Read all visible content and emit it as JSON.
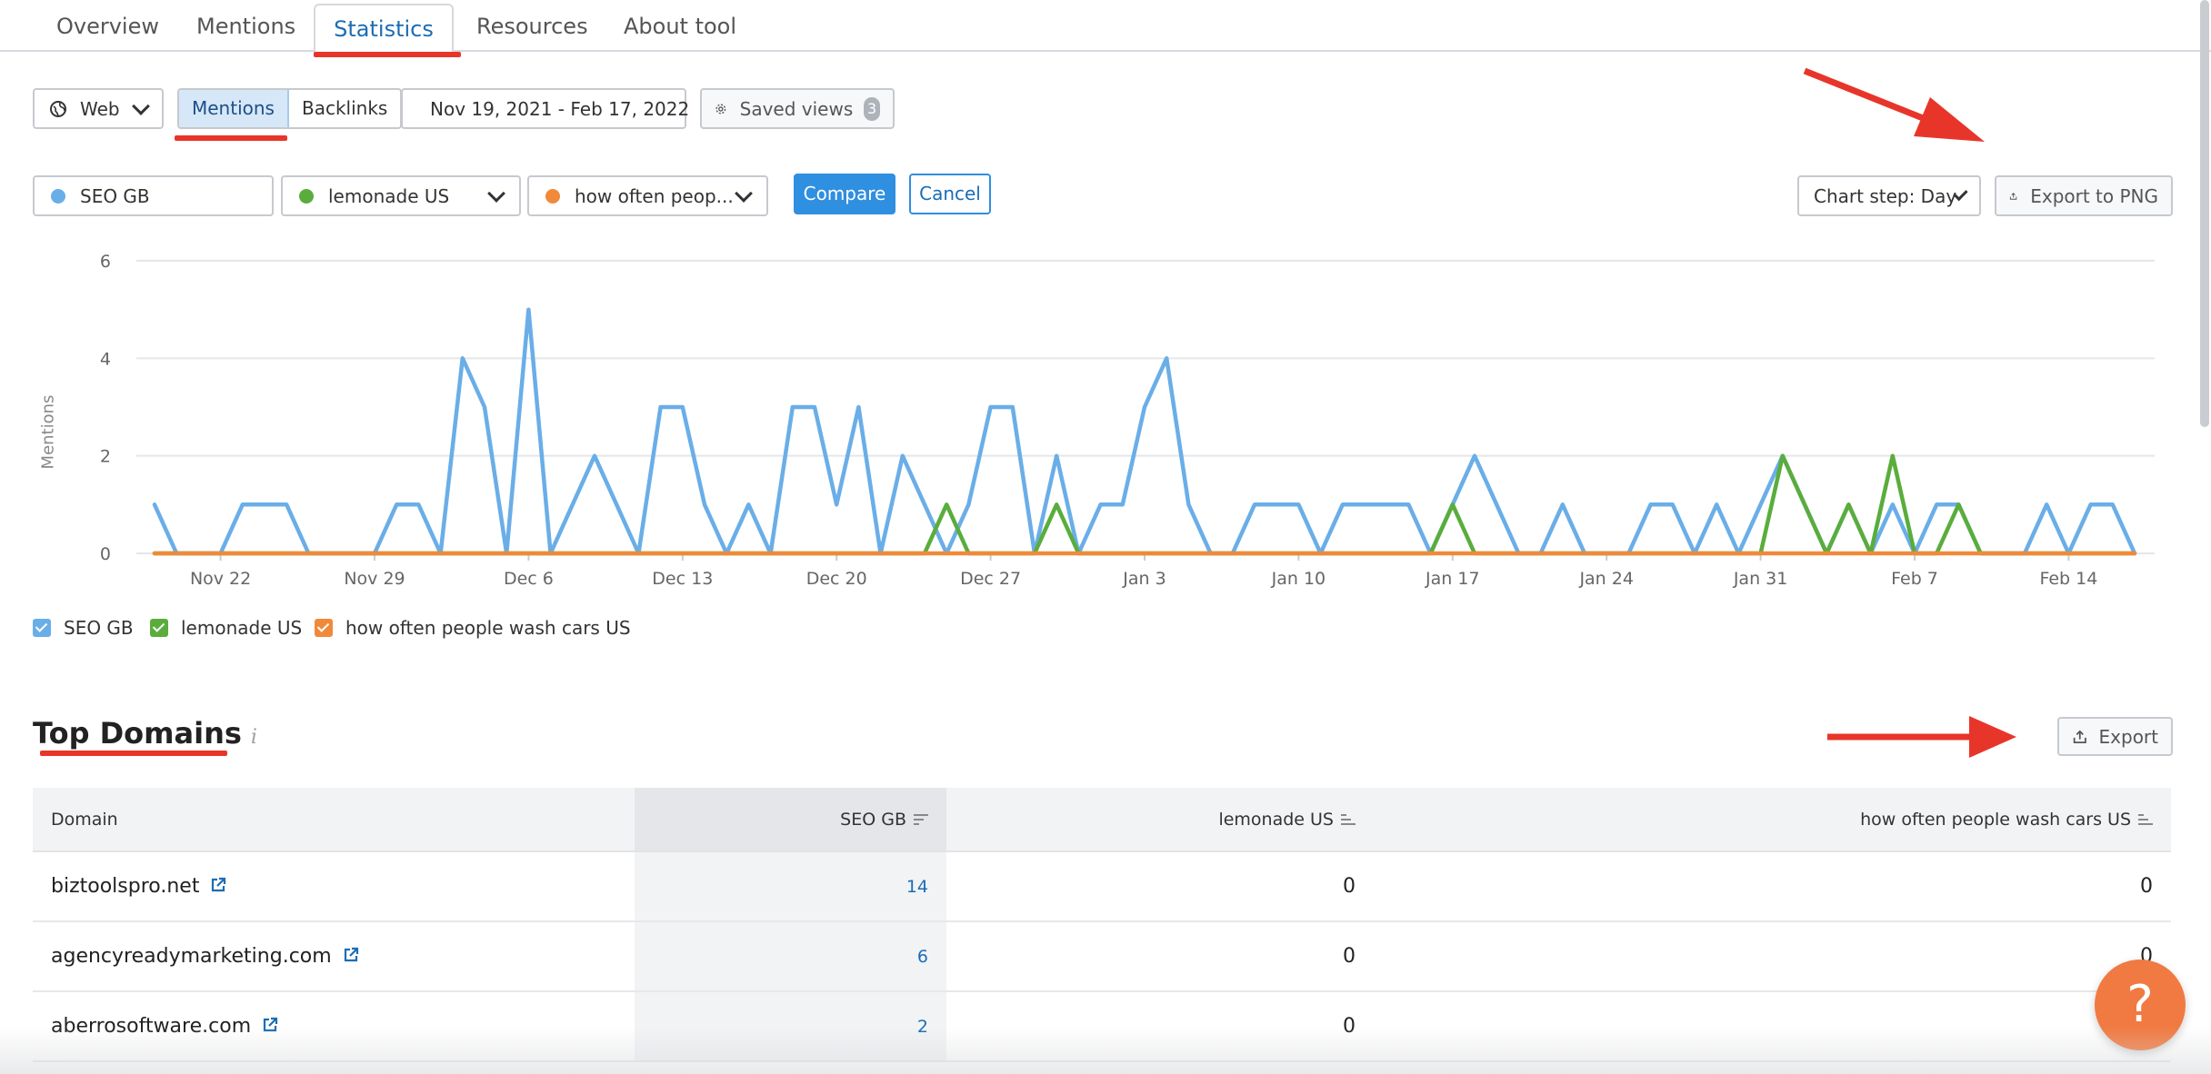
{
  "tabs": [
    {
      "label": "Overview"
    },
    {
      "label": "Mentions"
    },
    {
      "label": "Statistics"
    },
    {
      "label": "Resources"
    },
    {
      "label": "About tool"
    }
  ],
  "toolbar": {
    "source_label": "Web",
    "mentions_label": "Mentions",
    "backlinks_label": "Backlinks",
    "date_range": "Nov 19, 2021 - Feb 17, 2022",
    "saved_views_label": "Saved views",
    "saved_views_count": "3"
  },
  "compare": {
    "query1": "SEO GB",
    "query2": "lemonade US",
    "query3": "how often peop...",
    "compare_label": "Compare",
    "cancel_label": "Cancel",
    "chart_step": "Chart step: Day",
    "export_png": "Export to PNG"
  },
  "colors": {
    "blue": "#6aaee8",
    "green": "#5aad3c",
    "orange": "#f08a3a",
    "accent": "#2f8fe0",
    "annotation": "#e8352a"
  },
  "chart_data": {
    "type": "line",
    "ylabel": "Mentions",
    "ylim": [
      0,
      6
    ],
    "yticks": [
      "6",
      "4",
      "2",
      "0"
    ],
    "xtick_labels": [
      "Nov 22",
      "Nov 29",
      "Dec 6",
      "Dec 13",
      "Dec 20",
      "Dec 27",
      "Jan 3",
      "Jan 10",
      "Jan 17",
      "Jan 24",
      "Jan 31",
      "Feb 7",
      "Feb 14"
    ],
    "x_start": "Nov 19, 2021",
    "x_end": "Feb 17, 2022",
    "series": [
      {
        "name": "SEO GB",
        "color": "#6aaee8",
        "values": [
          1,
          0,
          0,
          0,
          1,
          1,
          1,
          0,
          0,
          0,
          0,
          1,
          1,
          0,
          4,
          3,
          0,
          5,
          0,
          1,
          2,
          1,
          0,
          3,
          3,
          1,
          0,
          1,
          0,
          3,
          3,
          1,
          3,
          0,
          2,
          1,
          0,
          1,
          3,
          3,
          0,
          2,
          0,
          1,
          1,
          3,
          4,
          1,
          0,
          0,
          1,
          1,
          1,
          0,
          1,
          1,
          1,
          1,
          0,
          1,
          2,
          1,
          0,
          0,
          1,
          0,
          0,
          0,
          1,
          1,
          0,
          1,
          0,
          1,
          2,
          1,
          0,
          1,
          0,
          1,
          0,
          1,
          1,
          0,
          0,
          0,
          1,
          0,
          1,
          1,
          0
        ]
      },
      {
        "name": "lemonade US",
        "color": "#5aad3c",
        "values": [
          0,
          0,
          0,
          0,
          0,
          0,
          0,
          0,
          0,
          0,
          0,
          0,
          0,
          0,
          0,
          0,
          0,
          0,
          0,
          0,
          0,
          0,
          0,
          0,
          0,
          0,
          0,
          0,
          0,
          0,
          0,
          0,
          0,
          0,
          0,
          0,
          1,
          0,
          0,
          0,
          0,
          1,
          0,
          0,
          0,
          0,
          0,
          0,
          0,
          0,
          0,
          0,
          0,
          0,
          0,
          0,
          0,
          0,
          0,
          1,
          0,
          0,
          0,
          0,
          0,
          0,
          0,
          0,
          0,
          0,
          0,
          0,
          0,
          0,
          2,
          1,
          0,
          1,
          0,
          2,
          0,
          0,
          1,
          0,
          0,
          0,
          0,
          0,
          0,
          0,
          0
        ]
      },
      {
        "name": "how often people wash cars US",
        "color": "#f08a3a",
        "values": [
          0,
          0,
          0,
          0,
          0,
          0,
          0,
          0,
          0,
          0,
          0,
          0,
          0,
          0,
          0,
          0,
          0,
          0,
          0,
          0,
          0,
          0,
          0,
          0,
          0,
          0,
          0,
          0,
          0,
          0,
          0,
          0,
          0,
          0,
          0,
          0,
          0,
          0,
          0,
          0,
          0,
          0,
          0,
          0,
          0,
          0,
          0,
          0,
          0,
          0,
          0,
          0,
          0,
          0,
          0,
          0,
          0,
          0,
          0,
          0,
          0,
          0,
          0,
          0,
          0,
          0,
          0,
          0,
          0,
          0,
          0,
          0,
          0,
          0,
          0,
          0,
          0,
          0,
          0,
          0,
          0,
          0,
          0,
          0,
          0,
          0,
          0,
          0,
          0,
          0,
          0
        ]
      }
    ]
  },
  "legend": {
    "item1": "SEO GB",
    "item2": "lemonade US",
    "item3": "how often people wash cars US"
  },
  "top_domains": {
    "title": "Top Domains",
    "info": "i",
    "export_label": "Export",
    "headers": {
      "domain": "Domain",
      "col1": "SEO GB",
      "col2": "lemonade US",
      "col3": "how often people wash cars US"
    },
    "rows": [
      {
        "domain": "biztoolspro.net",
        "seo": "14",
        "lemonade": "0",
        "wash": "0"
      },
      {
        "domain": "agencyreadymarketing.com",
        "seo": "6",
        "lemonade": "0",
        "wash": "0"
      },
      {
        "domain": "aberrosoftware.com",
        "seo": "2",
        "lemonade": "0",
        "wash": "0"
      }
    ]
  },
  "help_label": "?"
}
